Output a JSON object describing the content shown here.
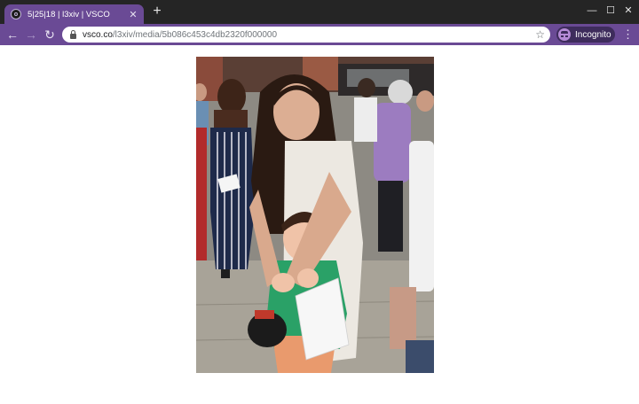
{
  "browser": {
    "tab": {
      "title": "5|25|18 | l3xiv | VSCO",
      "favicon": "vsco-favicon-icon",
      "close_glyph": "✕"
    },
    "new_tab_glyph": "+",
    "window_controls": {
      "minimize_glyph": "—",
      "maximize_glyph": "☐",
      "close_glyph": "✕"
    },
    "toolbar": {
      "back_glyph": "←",
      "forward_glyph": "→",
      "reload_glyph": "↻",
      "url_host": "vsco.co",
      "url_path": "/l3xiv/media/5b086c453c4db2320f000000",
      "bookmark_glyph": "☆",
      "incognito_label": "Incognito",
      "menu_glyph": "⋮"
    },
    "colors": {
      "frame": "#6a4a95",
      "tabstrip": "#252525",
      "incognito_pill": "#3e2c5c"
    }
  },
  "page": {
    "photo": {
      "subject": "photo-of-girl-hugging-boy-at-outdoor-event"
    }
  }
}
